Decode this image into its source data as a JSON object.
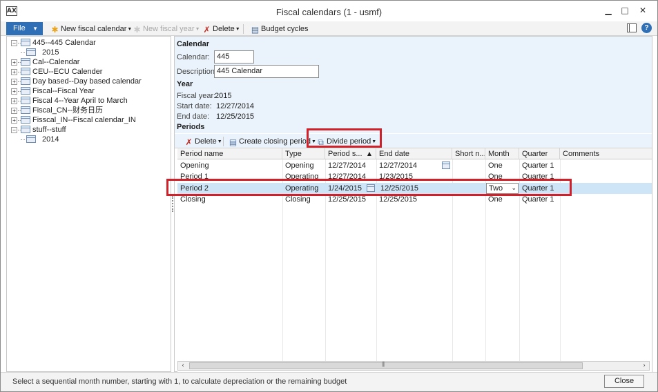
{
  "window": {
    "title": "Fiscal calendars (1 - usmf)",
    "app_icon": "AX",
    "minimize": "▁",
    "maximize": "□",
    "close": "✕"
  },
  "toolbar": {
    "file_label": "File",
    "new_fiscal_calendar": "New fiscal calendar",
    "new_fiscal_year": "New fiscal year",
    "delete": "Delete",
    "budget_cycles": "Budget cycles",
    "help": "?"
  },
  "tree": {
    "items": [
      {
        "label": "445--445 Calendar",
        "expander": "−"
      },
      {
        "label": "2015"
      },
      {
        "label": "Cal--Calendar",
        "expander": "+"
      },
      {
        "label": "CEU--ECU Calender",
        "expander": "+"
      },
      {
        "label": "Day based--Day based calendar",
        "expander": "+"
      },
      {
        "label": "Fiscal--Fiscal Year",
        "expander": "+"
      },
      {
        "label": "Fiscal 4--Year April to March",
        "expander": "+"
      },
      {
        "label": "Fiscal_CN--财务日历",
        "expander": "+"
      },
      {
        "label": "Fisscal_IN--Fiscal calendar_IN",
        "expander": "+"
      },
      {
        "label": "stuff--stuff",
        "expander": "−"
      },
      {
        "label": "2014"
      }
    ]
  },
  "calendar": {
    "section": "Calendar",
    "calendar_label": "Calendar:",
    "calendar_value": "445",
    "description_label": "Description:",
    "description_value": "445 Calendar"
  },
  "year": {
    "section": "Year",
    "fiscal_year_label": "Fiscal year:",
    "fiscal_year_value": "2015",
    "start_date_label": "Start date:",
    "start_date_value": "12/27/2014",
    "end_date_label": "End date:",
    "end_date_value": "12/25/2015"
  },
  "periods": {
    "section": "Periods",
    "delete": "Delete",
    "create_closing_period": "Create closing period",
    "divide_period": "Divide period",
    "columns": [
      "Period name",
      "Type",
      "Period s...",
      "End date",
      "Short n...",
      "Month",
      "Quarter",
      "Comments"
    ],
    "sort_indicator": "▲",
    "rows": [
      {
        "name": "Opening",
        "type": "Opening",
        "start": "12/27/2014",
        "end": "12/27/2014",
        "short": "",
        "month": "One",
        "quarter": "Quarter 1",
        "comments": ""
      },
      {
        "name": "Period 1",
        "type": "Operating",
        "start": "12/27/2014",
        "end": "1/23/2015",
        "short": "",
        "month": "One",
        "quarter": "Quarter 1",
        "comments": ""
      },
      {
        "name": "Period 2",
        "type": "Operating",
        "start": "1/24/2015",
        "end": "12/25/2015",
        "short": "",
        "month": "Two",
        "quarter": "Quarter 1",
        "comments": ""
      },
      {
        "name": "Closing",
        "type": "Closing",
        "start": "12/25/2015",
        "end": "12/25/2015",
        "short": "",
        "month": "One",
        "quarter": "Quarter 1",
        "comments": ""
      }
    ]
  },
  "status": {
    "text": "Select a sequential month number, starting with 1, to calculate depreciation or the remaining budget",
    "close_label": "Close"
  },
  "colors": {
    "accent": "#2e6fb6",
    "highlight": "#d0212a",
    "selected_row": "#cde5f7",
    "detail_bg": "#eaf3fb"
  }
}
